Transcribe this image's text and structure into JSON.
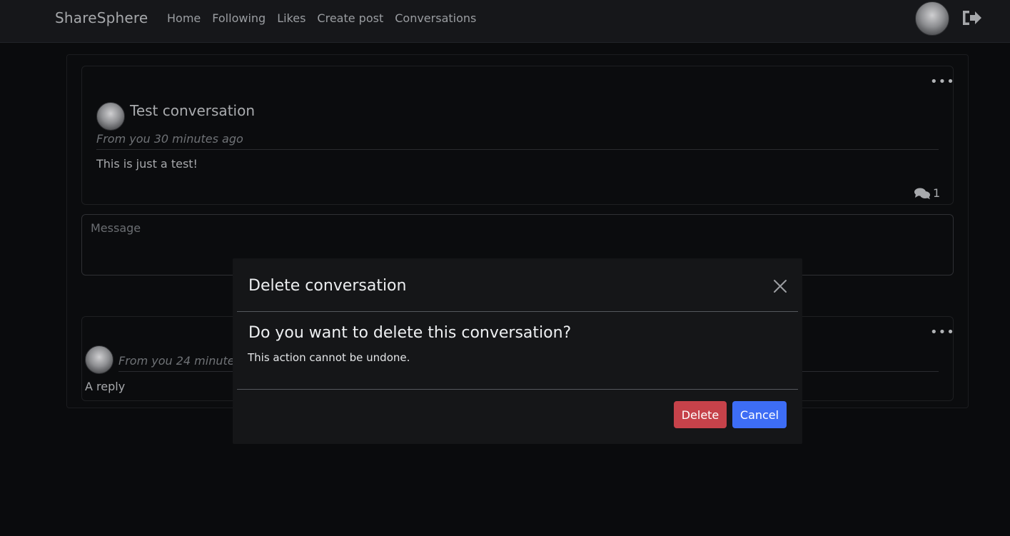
{
  "navbar": {
    "brand": "ShareSphere",
    "links": [
      "Home",
      "Following",
      "Likes",
      "Create post",
      "Conversations"
    ]
  },
  "post": {
    "title": "Test conversation",
    "meta": "From you 30 minutes ago",
    "body": "This is just a test!",
    "comment_count": "1"
  },
  "message": {
    "placeholder": "Message"
  },
  "reply": {
    "meta": "From you 24 minute",
    "body": "A reply"
  },
  "modal": {
    "title": "Delete conversation",
    "question": "Do you want to delete this conversation?",
    "note": "This action cannot be undone.",
    "delete_label": "Delete",
    "cancel_label": "Cancel"
  },
  "icons": {
    "menu": "ellipsis-icon",
    "comments": "comments-icon",
    "logout": "logout-icon",
    "close": "close-icon"
  },
  "colors": {
    "delete": "#c6424a",
    "cancel": "#3d6df5"
  }
}
